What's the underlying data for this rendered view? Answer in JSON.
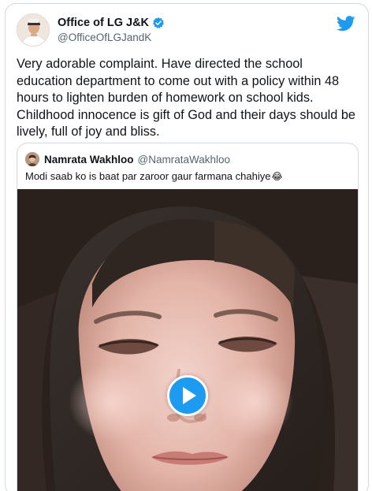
{
  "tweet": {
    "author_name": "Office of LG J&K",
    "author_handle": "@OfficeOfLGJandK",
    "verified": true,
    "text": "Very adorable complaint. Have directed the school education department to come out with a policy within 48 hours to lighten burden of homework on school kids. Childhood innocence is gift of God and their days should be lively, full of joy and bliss."
  },
  "quoted_tweet": {
    "author_name": "Namrata Wakhloo",
    "author_handle": "@NamrataWakhloo",
    "text": "Modi saab ko is baat par zaroor gaur farmana chahiye",
    "emoji": "😂"
  },
  "icons": {
    "brand": "twitter-bird-icon",
    "verified": "verified-badge-icon",
    "play": "play-icon"
  },
  "colors": {
    "twitter_blue": "#1d9bf0",
    "text_primary": "#0f1419",
    "text_secondary": "#536471",
    "border": "#cfd9de"
  }
}
